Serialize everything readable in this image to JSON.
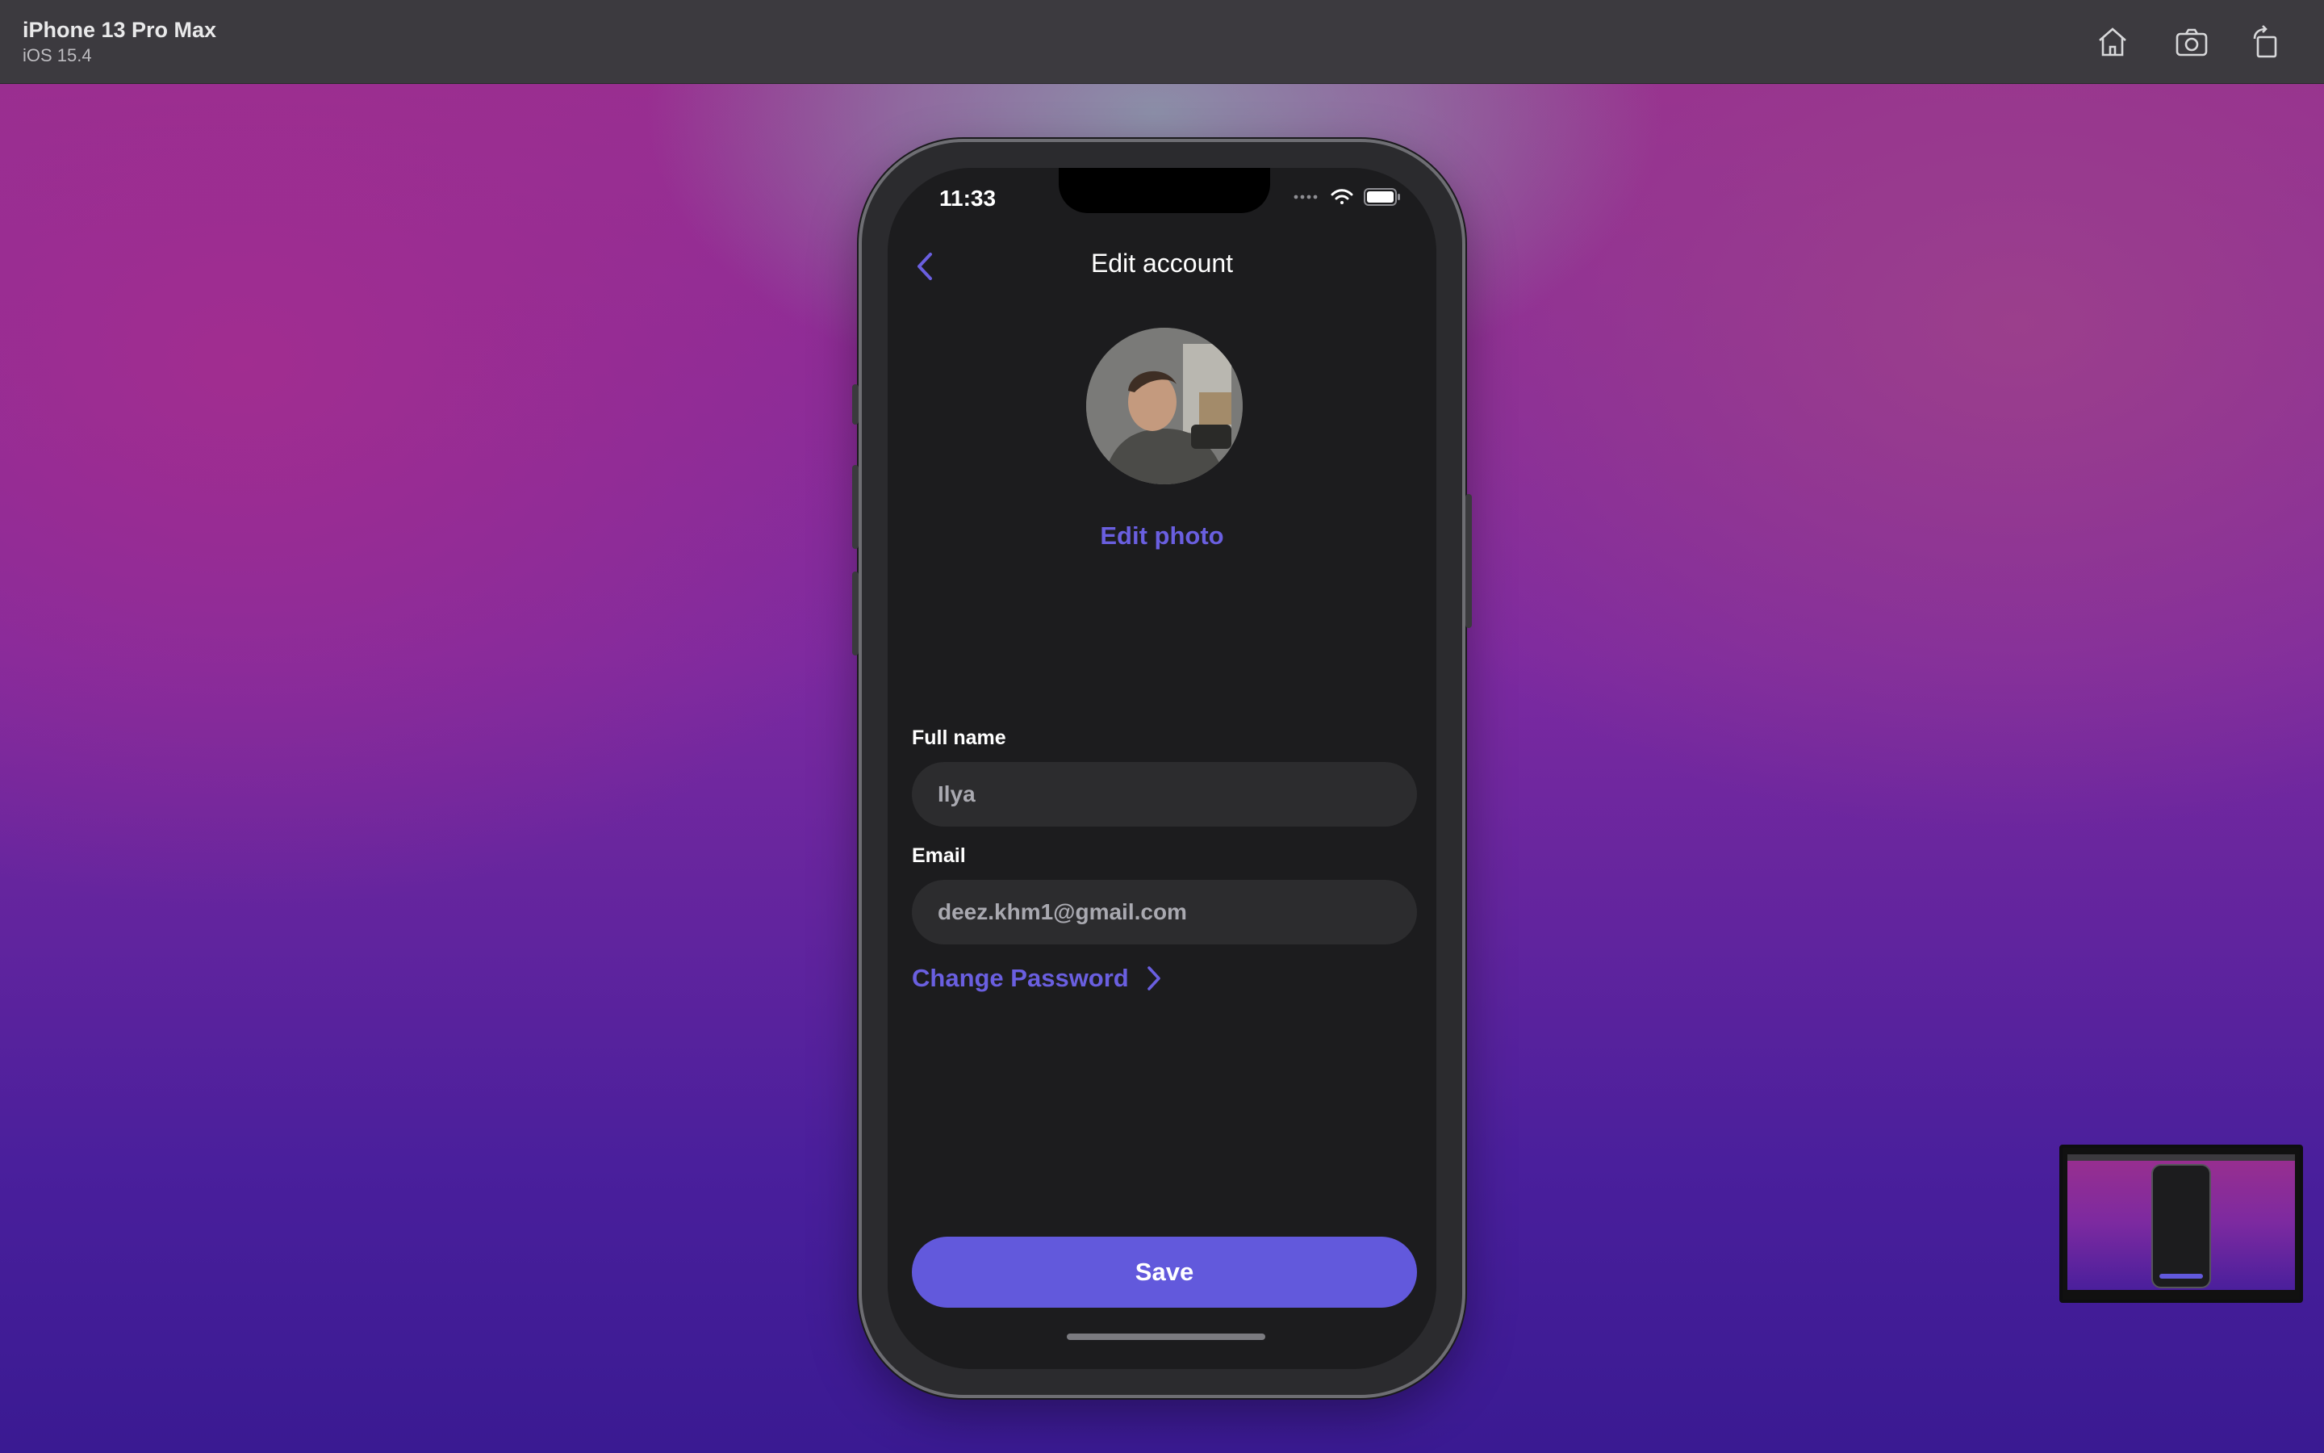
{
  "simulator": {
    "device_name": "iPhone 13 Pro Max",
    "os_version": "iOS 15.4",
    "tools": [
      "home-icon",
      "screenshot-icon",
      "rotate-icon"
    ]
  },
  "status_bar": {
    "time": "11:33"
  },
  "screen": {
    "title": "Edit account",
    "edit_photo_label": "Edit photo",
    "full_name": {
      "label": "Full name",
      "value": "Ilya"
    },
    "email": {
      "label": "Email",
      "value": "deez.khm1@gmail.com"
    },
    "change_password_label": "Change Password",
    "save_label": "Save"
  },
  "colors": {
    "accent": "#6259dc",
    "link": "#6a5fe0",
    "screen_bg": "#1c1c1e",
    "field_bg": "#2c2c2e"
  }
}
